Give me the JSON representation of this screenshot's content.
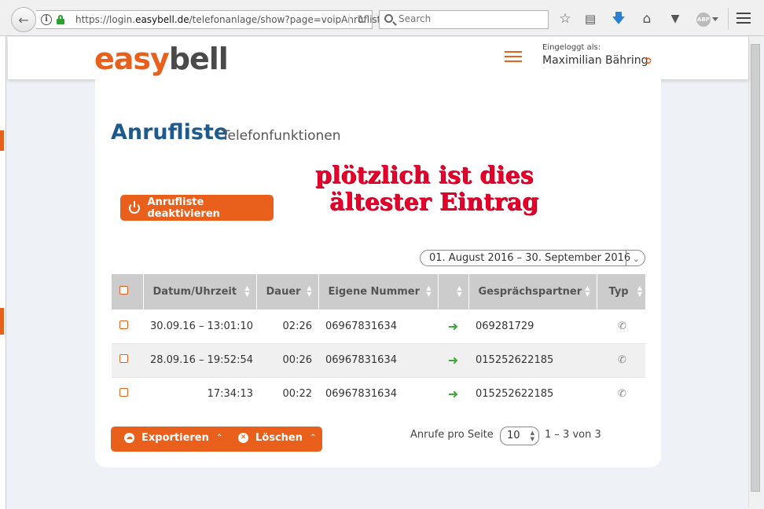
{
  "browser": {
    "url_prefix": "https://login.",
    "url_domain": "easybell.de",
    "url_suffix": "/telefonanlage/show?page=voipAnrufliste#",
    "search_placeholder": "Search",
    "abp_label": "ABP"
  },
  "header": {
    "logo_easy": "easy",
    "logo_bell": "bell",
    "login_label": "Eingeloggt als:",
    "user_name": "Maximilian Bähring"
  },
  "page": {
    "title": "Anrufliste",
    "subtitle": "Telefonfunktionen",
    "deactivate_label": "Anrufliste deaktivieren",
    "date_range": "01. August 2016 – 30. September 2016",
    "annotation_line1": "plötzlich ist dies",
    "annotation_line2": "ältester Eintrag"
  },
  "table": {
    "headers": [
      "Datum/Uhrzeit",
      "Dauer",
      "Eigene Nummer",
      "",
      "Gesprächspartner",
      "Typ"
    ],
    "rows": [
      {
        "datetime": "30.09.16 – 13:01:10",
        "duration": "02:26",
        "own_number": "06967831634",
        "partner": "069281729"
      },
      {
        "datetime": "28.09.16 – 19:52:54",
        "duration": "00:26",
        "own_number": "06967831634",
        "partner": "015252622185"
      },
      {
        "datetime": "17:34:13",
        "duration": "00:22",
        "own_number": "06967831634",
        "partner": "015252622185"
      }
    ]
  },
  "footer": {
    "export_label": "Exportieren",
    "delete_label": "Löschen",
    "per_page_label": "Anrufe pro Seite",
    "per_page_value": "10",
    "range_text": "1 – 3 von 3"
  },
  "colors": {
    "accent": "#e8601c",
    "title_blue": "#1e5a8c",
    "annotation_red": "#e4002b",
    "arrow_green": "#3aaa35"
  }
}
